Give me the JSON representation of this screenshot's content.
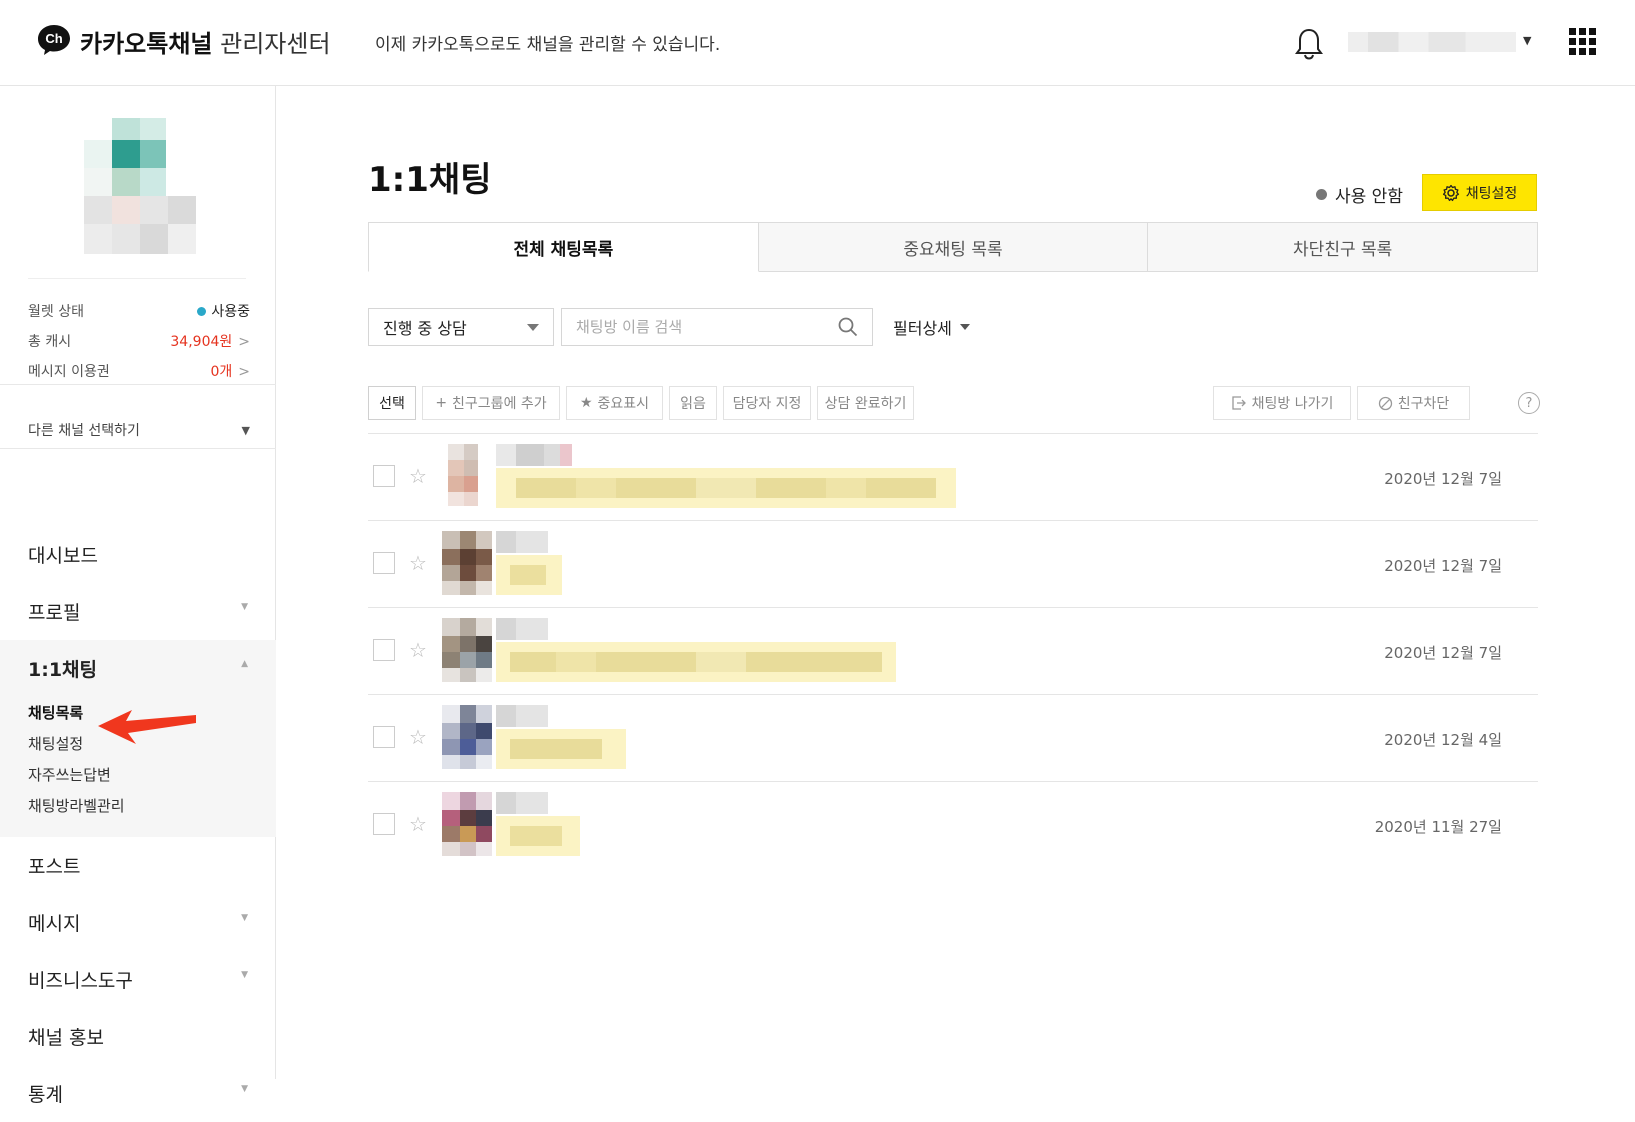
{
  "header": {
    "logo_badge": "Ch",
    "brand_bold": "카카오톡채널",
    "brand_light": "관리자센터",
    "notice": "이제 카카오톡으로도 채널을 관리할 수 있습니다."
  },
  "sidebar": {
    "wallet": [
      {
        "label": "월렛 상태",
        "value": "사용중"
      },
      {
        "label": "총 캐시",
        "value": "34,904원"
      },
      {
        "label": "메시지 이용권",
        "value": "0개"
      }
    ],
    "channel_select": "다른 채널 선택하기",
    "nav": [
      {
        "label": "대시보드"
      },
      {
        "label": "프로필"
      },
      {
        "label": "1:1채팅"
      },
      {
        "label": "포스트"
      },
      {
        "label": "메시지"
      },
      {
        "label": "비즈니스도구"
      },
      {
        "label": "채널 홍보"
      },
      {
        "label": "통계"
      }
    ],
    "sub_items": [
      "채팅목록",
      "채팅설정",
      "자주쓰는답변",
      "채팅방라벨관리"
    ]
  },
  "main": {
    "title": "1:1채팅",
    "status": "사용 안함",
    "settings_button": "채팅설정",
    "tabs": [
      "전체 채팅목록",
      "중요채팅 목록",
      "차단친구 목록"
    ],
    "status_filter": "진행 중 상담",
    "search_placeholder": "채팅방 이름 검색",
    "filter_detail": "필터상세",
    "actions": {
      "select": "선택",
      "add_group": "친구그룹에 추가",
      "mark_important": "중요표시",
      "mark_read": "읽음",
      "assign": "담당자 지정",
      "complete": "상담 완료하기",
      "leave": "채팅방 나가기",
      "block": "친구차단",
      "help": "?"
    },
    "chats": [
      {
        "date": "2020년 12월 7일"
      },
      {
        "date": "2020년 12월 7일"
      },
      {
        "date": "2020년 12월 7일"
      },
      {
        "date": "2020년 12월 4일"
      },
      {
        "date": "2020년 11월 27일"
      }
    ]
  },
  "colors": {
    "accent_yellow": "#fee500",
    "status_dot": "#2aa8c9",
    "cash_red": "#e5331f",
    "annotation_arrow": "#f0371e"
  }
}
